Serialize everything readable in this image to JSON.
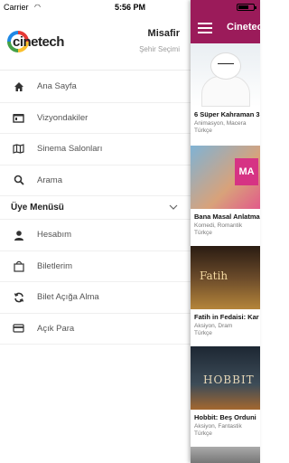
{
  "status_bar": {
    "carrier": "Carrier",
    "wifi_icon": "wifi-icon",
    "time": "5:56 PM",
    "battery_icon": "battery-icon",
    "battery_level": 0.6
  },
  "drawer": {
    "logo_text": "cinetech",
    "user_name": "Misafir",
    "city_select": "Şehir Seçimi",
    "items": [
      {
        "label": "Ana Sayfa",
        "icon": "home-icon"
      },
      {
        "label": "Vizyondakiler",
        "icon": "film-icon"
      },
      {
        "label": "Sinema Salonları",
        "icon": "map-icon"
      },
      {
        "label": "Arama",
        "icon": "search-icon"
      }
    ],
    "member_section": {
      "label": "Üye Menüsü",
      "icon": "chevron-down-icon",
      "items": [
        {
          "label": "Hesabım",
          "icon": "user-icon"
        },
        {
          "label": "Biletlerim",
          "icon": "bag-icon"
        },
        {
          "label": "Bilet Açığa Alma",
          "icon": "refresh-icon"
        },
        {
          "label": "Açık Para",
          "icon": "credit-card-icon"
        }
      ]
    }
  },
  "content": {
    "app_title": "Cinetech",
    "menu_icon": "hamburger-icon",
    "movies": [
      {
        "title": "6 Süper Kahraman 3",
        "genre": "Animasyon, Macera",
        "lang": "Türkçe"
      },
      {
        "title": "Bana Masal Anlatma",
        "genre": "Komedi, Romantik",
        "lang": "Türkçe",
        "poster_text": "MA"
      },
      {
        "title": "Fatih in Fedaisi: Kar",
        "genre": "Aksiyon, Dram",
        "lang": "Türkçe",
        "poster_text": "Fatih"
      },
      {
        "title": "Hobbit: Beş Orduni",
        "genre": "Aksiyon, Fantastik",
        "lang": "Türkçe",
        "poster_text": "HOBBIT"
      }
    ]
  },
  "colors": {
    "accent": "#9b1b5a"
  }
}
